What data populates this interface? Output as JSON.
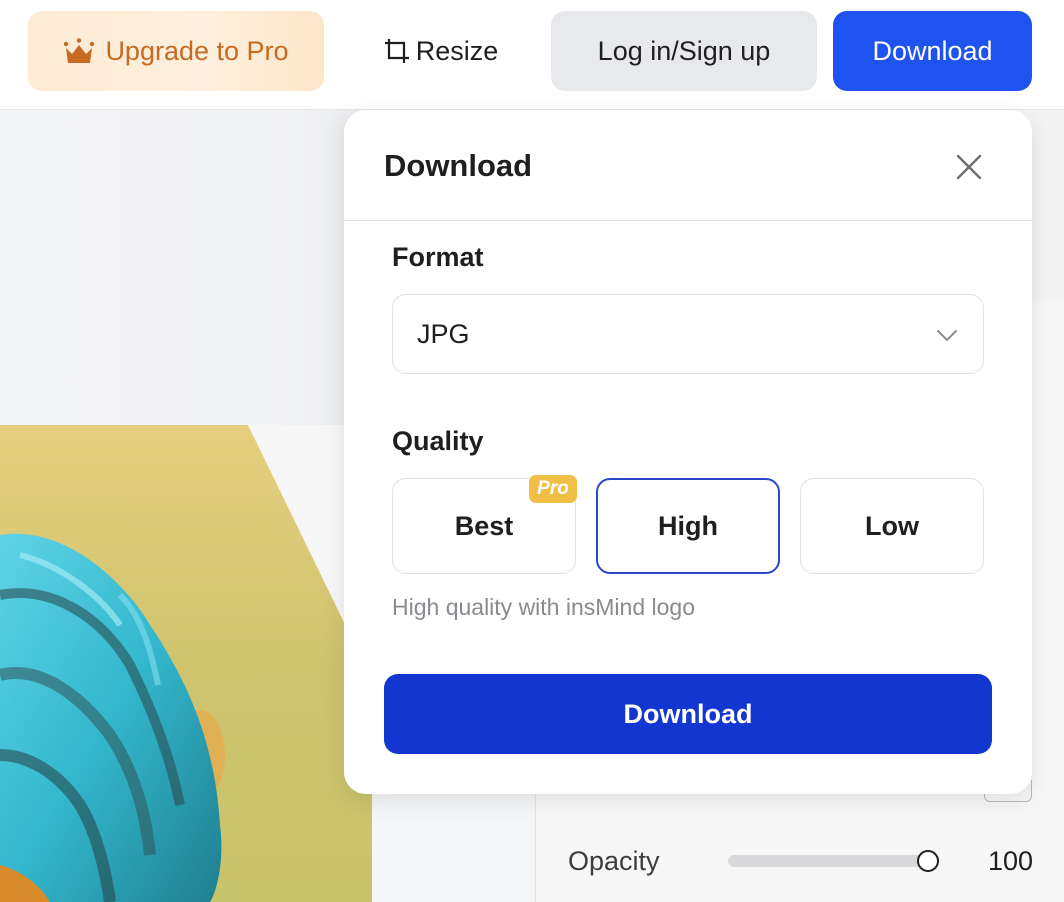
{
  "topbar": {
    "upgrade_label": "Upgrade to Pro",
    "upgrade_icon": "crown-icon",
    "resize_label": "Resize",
    "resize_icon": "crop-icon",
    "login_label": "Log in/Sign up",
    "download_label": "Download"
  },
  "modal": {
    "title": "Download",
    "close_icon": "close-icon",
    "format": {
      "label": "Format",
      "selected": "JPG",
      "chevron_icon": "chevron-down-icon"
    },
    "quality": {
      "label": "Quality",
      "options": [
        {
          "label": "Best",
          "badge": "Pro",
          "selected": false
        },
        {
          "label": "High",
          "selected": true
        },
        {
          "label": "Low",
          "selected": false
        }
      ],
      "hint": "High quality with insMind logo"
    },
    "download_label": "Download"
  },
  "properties": {
    "opacity_label": "Opacity",
    "opacity_value": "100",
    "opacity_percent": 100
  },
  "colors": {
    "primary": "#1f53f0",
    "modal_download": "#1336d0",
    "upgrade_text": "#c86a22",
    "upgrade_bg": "#fdebd4",
    "pro_badge": "#f0bf45",
    "selected_border": "#2b47c6"
  }
}
